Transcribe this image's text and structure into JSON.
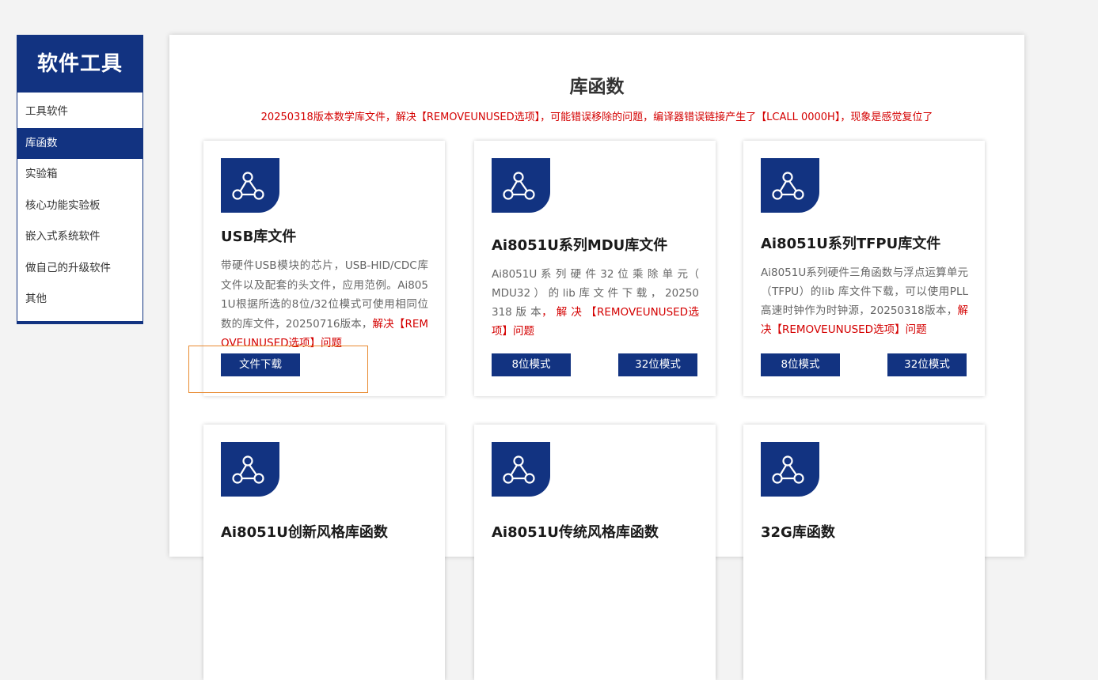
{
  "sidebar": {
    "title": "软件工具",
    "items": [
      {
        "label": "工具软件",
        "active": false
      },
      {
        "label": "库函数",
        "active": true
      },
      {
        "label": "实验箱",
        "active": false
      },
      {
        "label": "核心功能实验板",
        "active": false
      },
      {
        "label": "嵌入式系统软件",
        "active": false
      },
      {
        "label": "做自己的升级软件",
        "active": false
      },
      {
        "label": "其他",
        "active": false
      }
    ]
  },
  "main": {
    "title": "库函数",
    "notice": "20250318版本数学库文件，解决【REMOVEUNUSED选项】，可能错误移除的问题，编译器错误链接产生了【LCALL  0000H】，现象是感觉复位了",
    "cards": [
      {
        "icon": "share-network-icon",
        "title": "USB库文件",
        "desc": "带硬件USB模块的芯片，USB-HID/CDC库文件以及配套的头文件，应用范例。Ai8051U根据所选的8位/32位模式可使用相同位数的库文件，20250716版本，",
        "desc_red": "解决【REMOVEUNUSED选项】问题",
        "buttons": [
          "文件下载"
        ]
      },
      {
        "icon": "share-network-icon",
        "title": "Ai8051U系列MDU库文件",
        "desc": "Ai8051U 系 列 硬 件 32 位 乘 除 单 元（ MDU32 ） 的 lib 库 文 件 下 载 ， 20250318 版 本",
        "desc_red": "， 解 决 【REMOVEUNUSED选项】问题",
        "buttons": [
          "8位模式",
          "32位模式"
        ]
      },
      {
        "icon": "share-network-icon",
        "title": "Ai8051U系列TFPU库文件",
        "desc": "Ai8051U系列硬件三角函数与浮点运算单元（TFPU）的lib 库文件下载，可以使用PLL高速时钟作为时钟源，20250318版本，",
        "desc_red": "解决【REMOVEUNUSED选项】问题",
        "buttons": [
          "8位模式",
          "32位模式"
        ]
      },
      {
        "icon": "share-network-icon",
        "title": "Ai8051U创新风格库函数"
      },
      {
        "icon": "share-network-icon",
        "title": "Ai8051U传统风格库函数"
      },
      {
        "icon": "share-network-icon",
        "title": "32G库函数"
      }
    ]
  },
  "colors": {
    "brand": "#123381",
    "notice": "#d40000",
    "highlight": "#e8892e"
  }
}
